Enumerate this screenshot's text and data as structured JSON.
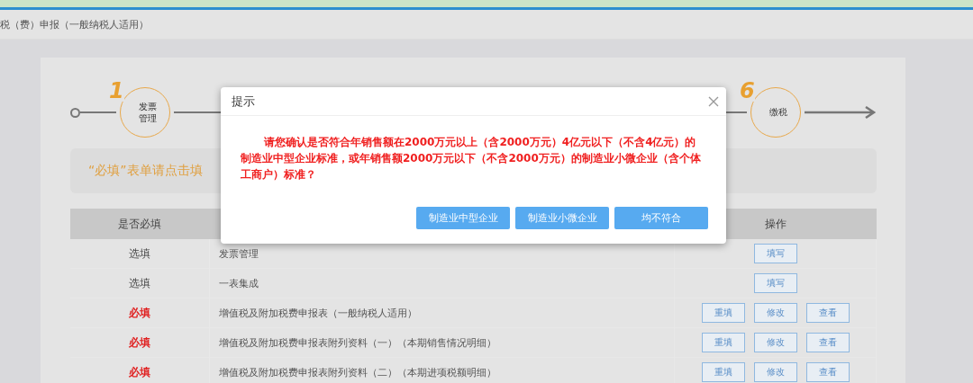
{
  "header": {
    "title": "税（费）申报（一般纳税人适用）"
  },
  "steps": [
    {
      "number": "1",
      "label": "发票管理"
    },
    {
      "number": "6",
      "label": "缴税"
    }
  ],
  "hint": {
    "text": "“必填”表单请点击填"
  },
  "table": {
    "columns": [
      "是否必填",
      "操作"
    ],
    "rows": [
      {
        "required": false,
        "status": "选填",
        "name": "发票管理",
        "actions": [
          "填写"
        ]
      },
      {
        "required": false,
        "status": "选填",
        "name": "一表集成",
        "actions": [
          "填写"
        ]
      },
      {
        "required": true,
        "status": "必填",
        "name": "增值税及附加税费申报表（一般纳税人适用）",
        "actions": [
          "重填",
          "修改",
          "查看"
        ]
      },
      {
        "required": true,
        "status": "必填",
        "name": "增值税及附加税费申报表附列资料（一）（本期销售情况明细）",
        "actions": [
          "重填",
          "修改",
          "查看"
        ]
      },
      {
        "required": true,
        "status": "必填",
        "name": "增值税及附加税费申报表附列资料（二）（本期进项税额明细）",
        "actions": [
          "重填",
          "修改",
          "查看"
        ]
      }
    ]
  },
  "dialog": {
    "title": "提示",
    "message": "请您确认是否符合年销售额在2000万元以上（含2000万元）4亿元以下（不含4亿元）的制造业中型企业标准，或年销售额2000万元以下（不含2000万元）的制造业小微企业（含个体工商户）标准？",
    "buttons": [
      "制造业中型企业",
      "制造业小微企业",
      "均不符合"
    ]
  }
}
